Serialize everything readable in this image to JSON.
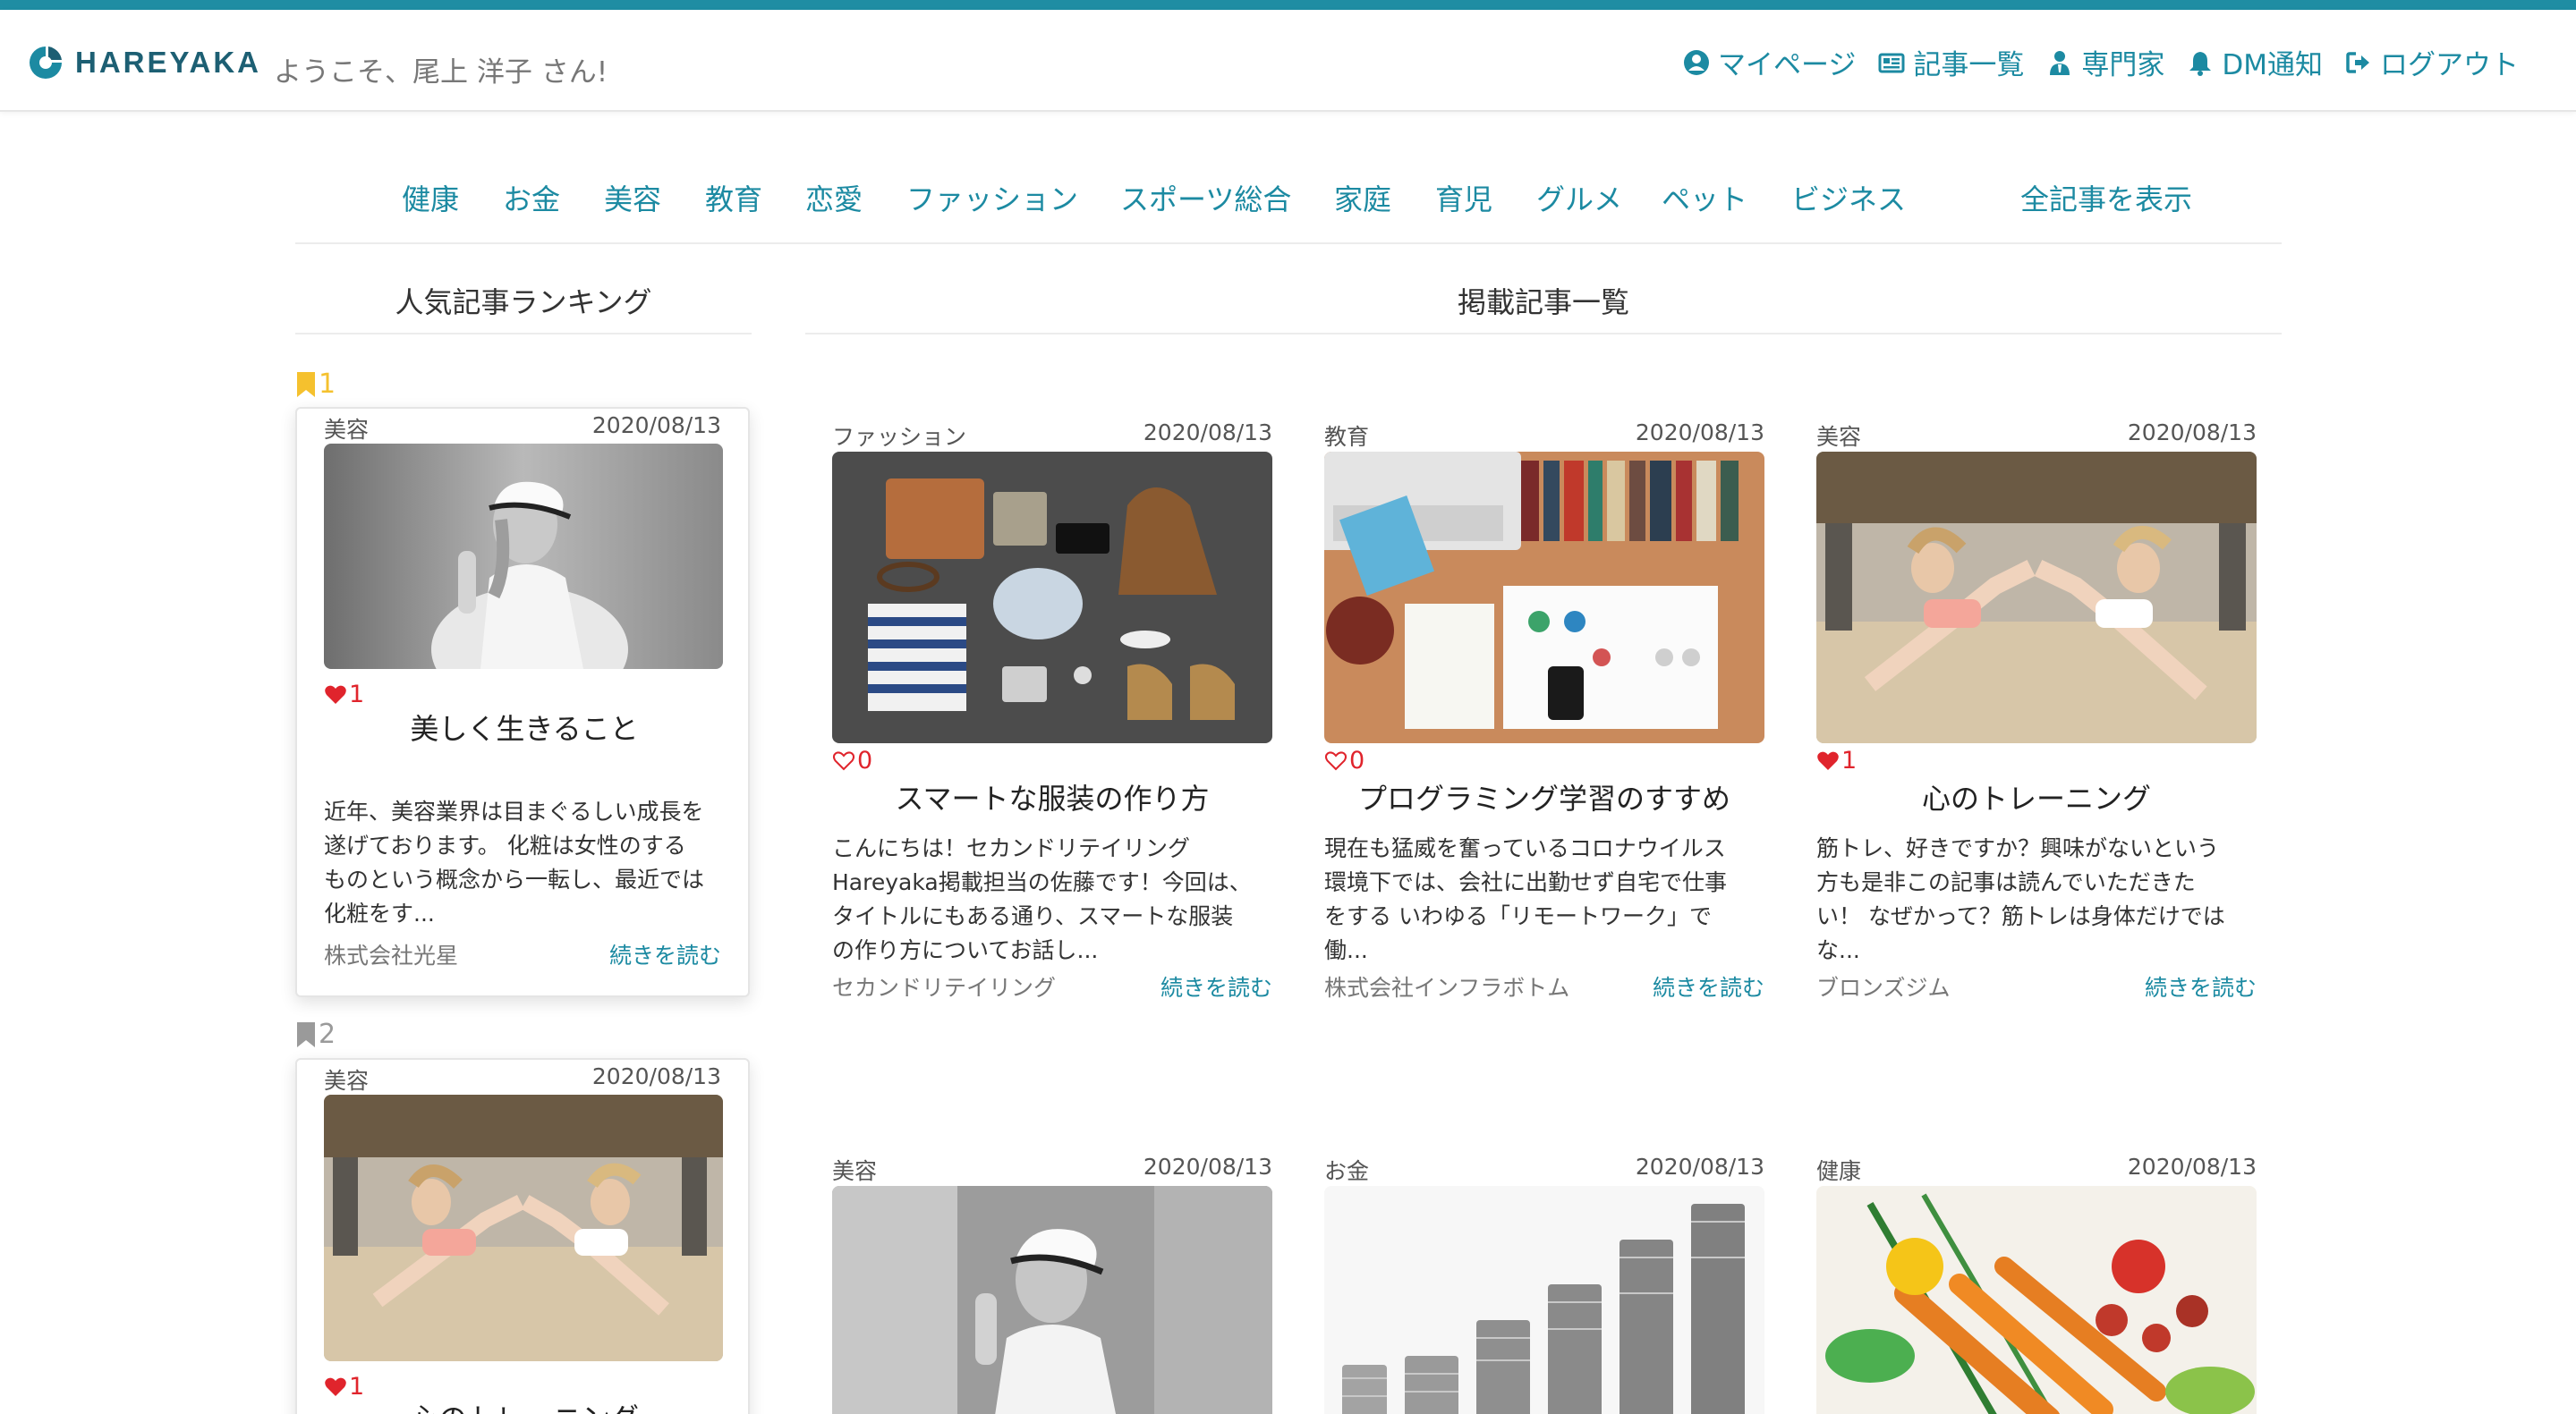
{
  "header": {
    "brand": "HAREYAKA",
    "welcome": "ようこそ、尾上 洋子 さん!",
    "nav": [
      {
        "label": "マイページ",
        "icon": "user-circle-icon"
      },
      {
        "label": "記事一覧",
        "icon": "newspaper-icon"
      },
      {
        "label": "専門家",
        "icon": "expert-icon"
      },
      {
        "label": "DM通知",
        "icon": "bell-icon"
      },
      {
        "label": "ログアウト",
        "icon": "sign-out-icon"
      }
    ]
  },
  "categories": [
    "健康",
    "お金",
    "美容",
    "教育",
    "恋愛",
    "ファッション",
    "スポーツ総合",
    "家庭",
    "育児",
    "グルメ",
    "ペット",
    "ビジネス"
  ],
  "show_all": "全記事を表示",
  "ranking": {
    "title": "人気記事ランキング",
    "items": [
      {
        "rank": "1",
        "category": "美容",
        "date": "2020/08/13",
        "likes": "1",
        "title": "美しく生きること",
        "excerpt": [
          "近年、美容業界は目まぐるしい成長を",
          "遂げております。 化粧は女性のする",
          "ものという概念から一転し、最近では",
          "化粧をす..."
        ],
        "author": "株式会社光星",
        "more": "続きを読む"
      },
      {
        "rank": "2",
        "category": "美容",
        "date": "2020/08/13",
        "likes": "1",
        "title": "心のトレーニング"
      }
    ]
  },
  "articles": {
    "title": "掲載記事一覧",
    "items": [
      {
        "category": "ファッション",
        "date": "2020/08/13",
        "likes": "0",
        "title": "スマートな服装の作り方",
        "excerpt": [
          "こんにちは！セカンドリテイリング",
          "Hareyaka掲載担当の佐藤です！今回は、",
          "タイトルにもある通り、スマートな服装",
          "の作り方についてお話し..."
        ],
        "author": "セカンドリテイリング",
        "more": "続きを読む"
      },
      {
        "category": "教育",
        "date": "2020/08/13",
        "likes": "0",
        "title": "プログラミング学習のすすめ",
        "excerpt": [
          "現在も猛威を奮っているコロナウイルス",
          "環境下では、会社に出勤せず自宅で仕事",
          "をする いわゆる「リモートワーク」で",
          "働..."
        ],
        "author": "株式会社インフラボトム",
        "more": "続きを読む"
      },
      {
        "category": "美容",
        "date": "2020/08/13",
        "likes": "1",
        "title": "心のトレーニング",
        "excerpt": [
          "筋トレ、好きですか？興味がないという",
          "方も是非この記事は読んでいただきた",
          "い！ なぜかって？筋トレは身体だけでは",
          "な..."
        ],
        "author": "ブロンズジム",
        "more": "続きを読む"
      },
      {
        "category": "美容",
        "date": "2020/08/13"
      },
      {
        "category": "お金",
        "date": "2020/08/13"
      },
      {
        "category": "健康",
        "date": "2020/08/13"
      }
    ]
  },
  "colors": {
    "accent": "#1c8aa2",
    "brand_bar": "#1f8da3",
    "like_red": "#e0242c",
    "rank_gold": "#f5c12e",
    "rank_gray": "#9a9a9a"
  }
}
